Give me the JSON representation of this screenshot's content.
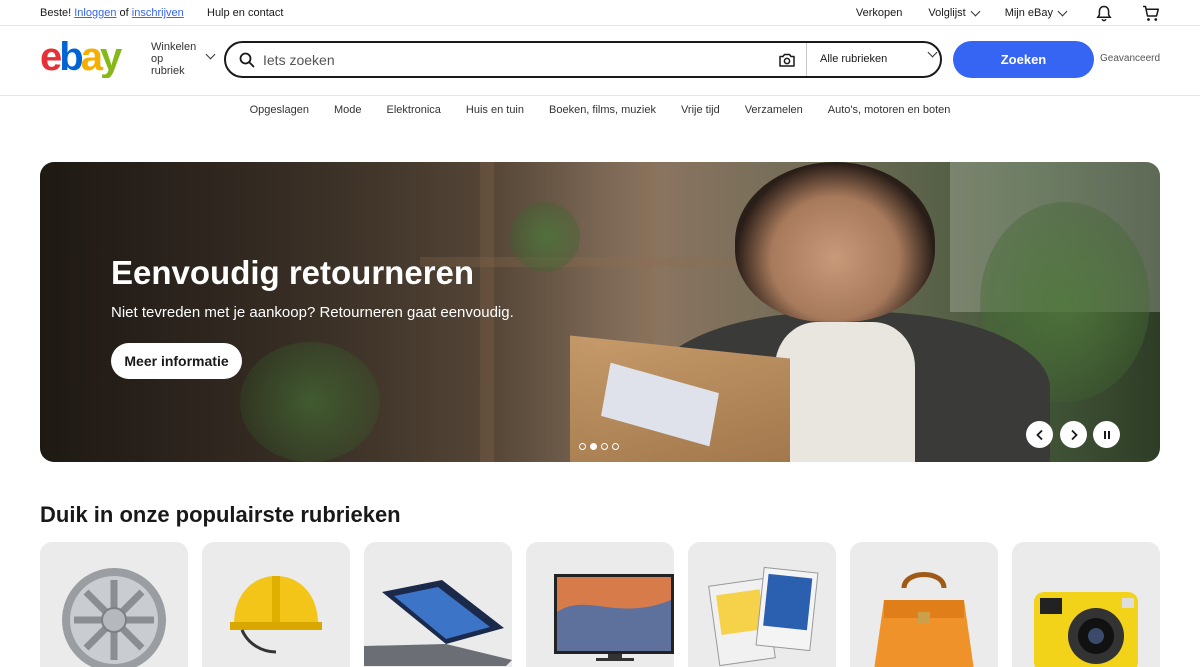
{
  "topbar": {
    "greeting": "Beste!",
    "login_link": "Inloggen",
    "or_text": "of",
    "register_link": "inschrijven",
    "help": "Hulp en contact",
    "sell": "Verkopen",
    "watchlist": "Volglijst",
    "my_ebay": "Mijn eBay",
    "icons": [
      "bell-icon",
      "cart-icon"
    ]
  },
  "header": {
    "logo_alt": "ebay",
    "shop_by_category": "Winkelen op rubriek",
    "search_placeholder": "Iets zoeken",
    "category_select": "Alle rubrieken",
    "search_button": "Zoeken",
    "advanced": "Geavanceerd",
    "colors": {
      "accent": "#3665f3",
      "logo_e": "#e53238",
      "logo_b": "#0064d2",
      "logo_a": "#f5af02",
      "logo_y": "#86b817"
    }
  },
  "category_nav": [
    "Opgeslagen",
    "Mode",
    "Elektronica",
    "Huis en tuin",
    "Boeken, films, muziek",
    "Vrije tijd",
    "Verzamelen",
    "Auto's, motoren en boten"
  ],
  "hero": {
    "title": "Eenvoudig retourneren",
    "subtitle": "Niet tevreden met je aankoop? Retourneren gaat eenvoudig.",
    "button": "Meer informatie",
    "slide_count": 4,
    "active_slide": 2,
    "controls": [
      "chevron-left-icon",
      "chevron-right-icon",
      "pause-icon"
    ]
  },
  "popular": {
    "title": "Duik in onze populairste rubrieken",
    "tiles": [
      "alloy-wheel",
      "safety-helmet",
      "laptop",
      "television",
      "trading-cards",
      "handbag",
      "camera"
    ]
  }
}
